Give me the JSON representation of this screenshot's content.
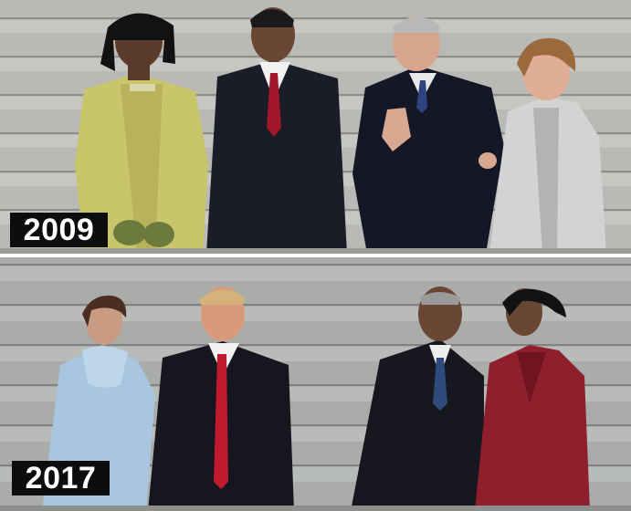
{
  "panels": [
    {
      "year_label": "2009"
    },
    {
      "year_label": "2017"
    }
  ]
}
